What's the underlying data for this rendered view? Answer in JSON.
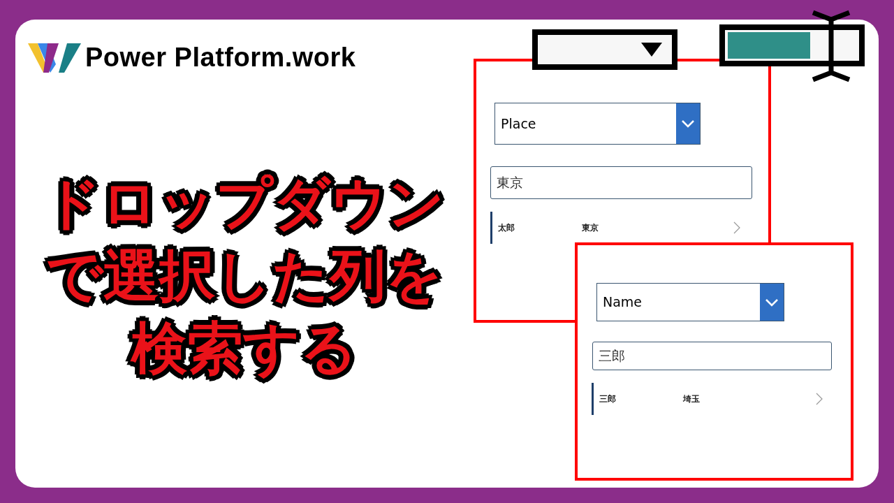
{
  "logo": {
    "text": "Power Platform.work"
  },
  "headline": [
    "ドロップダウン",
    "で選択した列を",
    "検索する"
  ],
  "panels": [
    {
      "dropdown": "Place",
      "search": "東京",
      "rows": [
        {
          "name": "太郎",
          "place": "東京"
        }
      ]
    },
    {
      "dropdown": "Name",
      "search": "三郎",
      "rows": [
        {
          "name": "三郎",
          "place": "埼玉"
        }
      ]
    }
  ]
}
